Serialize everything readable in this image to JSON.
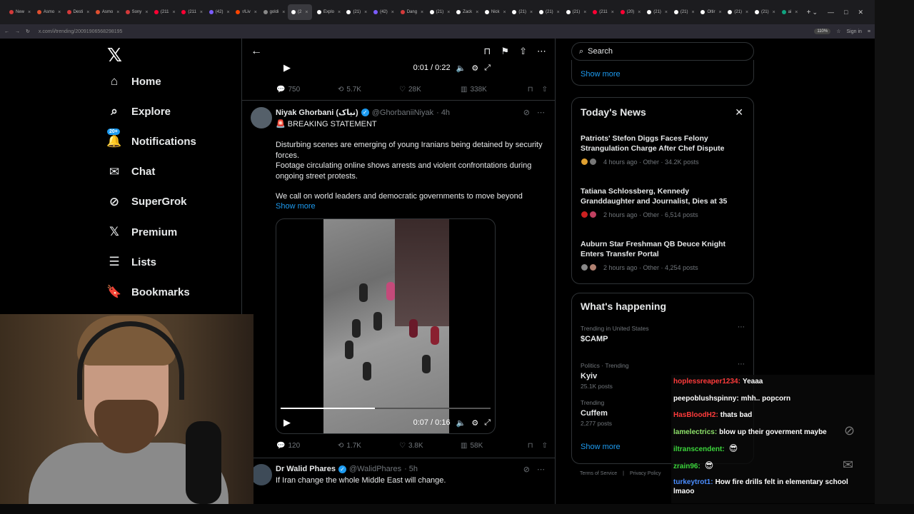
{
  "browser": {
    "tabs": [
      {
        "label": "New",
        "color": "#d43a3a"
      },
      {
        "label": "Asmo",
        "color": "#e05030"
      },
      {
        "label": "Desti",
        "color": "#d43a3a"
      },
      {
        "label": "Asmo",
        "color": "#e05030"
      },
      {
        "label": "Sony",
        "color": "#d43a3a"
      },
      {
        "label": "(211",
        "color": "#ff0033"
      },
      {
        "label": "(211",
        "color": "#ff0033"
      },
      {
        "label": "(42) ",
        "color": "#7b5cff"
      },
      {
        "label": "r/Liv",
        "color": "#ff4500"
      },
      {
        "label": "goldi",
        "color": "#888888"
      },
      {
        "label": "(2",
        "color": "#ffffff",
        "active": true
      },
      {
        "label": "Explo",
        "color": "#ffffff"
      },
      {
        "label": "(21)",
        "color": "#ffffff"
      },
      {
        "label": "(42) ",
        "color": "#7b5cff"
      },
      {
        "label": "Dang",
        "color": "#d43a3a"
      },
      {
        "label": "(21) ",
        "color": "#ffffff"
      },
      {
        "label": "Zack",
        "color": "#ffffff"
      },
      {
        "label": "Nick",
        "color": "#ffffff"
      },
      {
        "label": "(21)",
        "color": "#ffffff"
      },
      {
        "label": "(21)",
        "color": "#ffffff"
      },
      {
        "label": "(21)",
        "color": "#ffffff"
      },
      {
        "label": "(211",
        "color": "#ff0033"
      },
      {
        "label": "(20)",
        "color": "#ff0033"
      },
      {
        "label": "(21)",
        "color": "#ffffff"
      },
      {
        "label": "(21)",
        "color": "#ffffff"
      },
      {
        "label": "Oltir",
        "color": "#ffffff"
      },
      {
        "label": "(21)",
        "color": "#ffffff"
      },
      {
        "label": "(21)",
        "color": "#ffffff"
      },
      {
        "label": "ai",
        "color": "#10a37f"
      }
    ],
    "url": "x.com/i/trending/2009190656829819​5",
    "zoom": "110%",
    "signin": "Sign in"
  },
  "nav": {
    "items": [
      {
        "label": "Home",
        "icon": "⌂",
        "name": "home"
      },
      {
        "label": "Explore",
        "icon": "⌕",
        "name": "explore"
      },
      {
        "label": "Notifications",
        "icon": "🔔",
        "name": "notifications",
        "badge": "20+"
      },
      {
        "label": "Chat",
        "icon": "✉",
        "name": "chat"
      },
      {
        "label": "SuperGrok",
        "icon": "⊘",
        "name": "supergrok"
      },
      {
        "label": "Premium",
        "icon": "𝕏",
        "name": "premium"
      },
      {
        "label": "Lists",
        "icon": "☰",
        "name": "lists"
      },
      {
        "label": "Bookmarks",
        "icon": "🔖",
        "name": "bookmarks"
      }
    ]
  },
  "top_video": {
    "time": "0:01 / 0:22"
  },
  "top_engage": {
    "replies": "750",
    "reposts": "5.7K",
    "likes": "28K",
    "views": "338K"
  },
  "tweet1": {
    "name": "Niyak Ghorbani (نیاک)",
    "handle": "@GhorbaniiNiyak",
    "age": "· 4h",
    "headline": "🚨 BREAKING STATEMENT",
    "p1": "Disturbing scenes are emerging of young Iranians being detained by security forces.",
    "p2": "Footage circulating online shows arrests and violent confrontations during ongoing street protests.",
    "p3": "We call on world leaders and democratic governments to move beyond",
    "show_more": "Show more",
    "video_time": "0:07 / 0:16",
    "video_progress": 0.45,
    "engage": {
      "replies": "120",
      "reposts": "1.7K",
      "likes": "3.8K",
      "views": "58K"
    }
  },
  "tweet2": {
    "name": "Dr Walid Phares",
    "handle": "@WalidPhares",
    "age": "· 5h",
    "text": "If Iran change the whole Middle East will change."
  },
  "right": {
    "search_placeholder": "Search",
    "show_more": "Show more",
    "news_title": "Today's News",
    "news": [
      {
        "title": "Patriots' Stefon Diggs Faces Felony Strangulation Charge After Chef Dispute",
        "meta": "4 hours ago · Other · 34.2K posts"
      },
      {
        "title": "Tatiana Schlossberg, Kennedy Granddaughter and Journalist, Dies at 35",
        "meta": "2 hours ago · Other · 6,514 posts"
      },
      {
        "title": "Auburn Star Freshman QB Deuce Knight Enters Transfer Portal",
        "meta": "2 hours ago · Other · 4,254 posts"
      }
    ],
    "happening_title": "What's happening",
    "trends": [
      {
        "category": "Trending in United States",
        "name": "$CAMP",
        "posts": ""
      },
      {
        "category": "Politics · Trending",
        "name": "Kyiv",
        "posts": "25.1K posts"
      },
      {
        "category": "Trending",
        "name": "Cuffem",
        "posts": "2,277 posts"
      }
    ],
    "show_more2": "Show more",
    "footer": [
      "Terms of Service",
      "|",
      "Privacy Policy"
    ]
  },
  "chat": {
    "lines": [
      {
        "user": "hoplessreaper1234:",
        "msg": "Yeaaa",
        "color": "#ff3b3b"
      },
      {
        "user": "peepoblushspinny:",
        "msg": "mhh.. popcorn",
        "color": "#ffffff"
      },
      {
        "user": "HasBloodH2:",
        "msg": "thats bad",
        "color": "#ff3b3b"
      },
      {
        "user": "lamelectrics:",
        "msg": "blow up their goverment maybe",
        "color": "#8ee26a"
      },
      {
        "user": "iltranscendent:",
        "msg": "",
        "color": "#3cd63c"
      },
      {
        "user": "zrain96:",
        "msg": "",
        "color": "#3cd63c"
      },
      {
        "user": "turkeytrot1:",
        "msg": "How fire drills felt in elementary school lmaoo",
        "color": "#4a8dff"
      }
    ]
  }
}
